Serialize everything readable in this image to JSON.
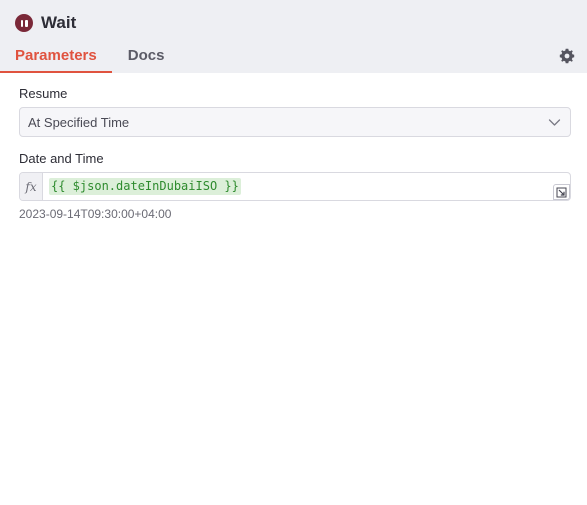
{
  "node": {
    "title": "Wait",
    "icon": "pause-circle-icon",
    "icon_color": "#7a2838"
  },
  "tabs": [
    {
      "label": "Parameters",
      "active": true
    },
    {
      "label": "Docs",
      "active": false
    }
  ],
  "settings_icon": "gear-icon",
  "accent_color": "#e0533f",
  "fields": {
    "resume": {
      "label": "Resume",
      "value": "At Specified Time"
    },
    "date_time": {
      "label": "Date and Time",
      "fx_label": "fx",
      "expression": "{{ $json.dateInDubaiISO }}",
      "resolved_value": "2023-09-14T09:30:00+04:00"
    }
  }
}
